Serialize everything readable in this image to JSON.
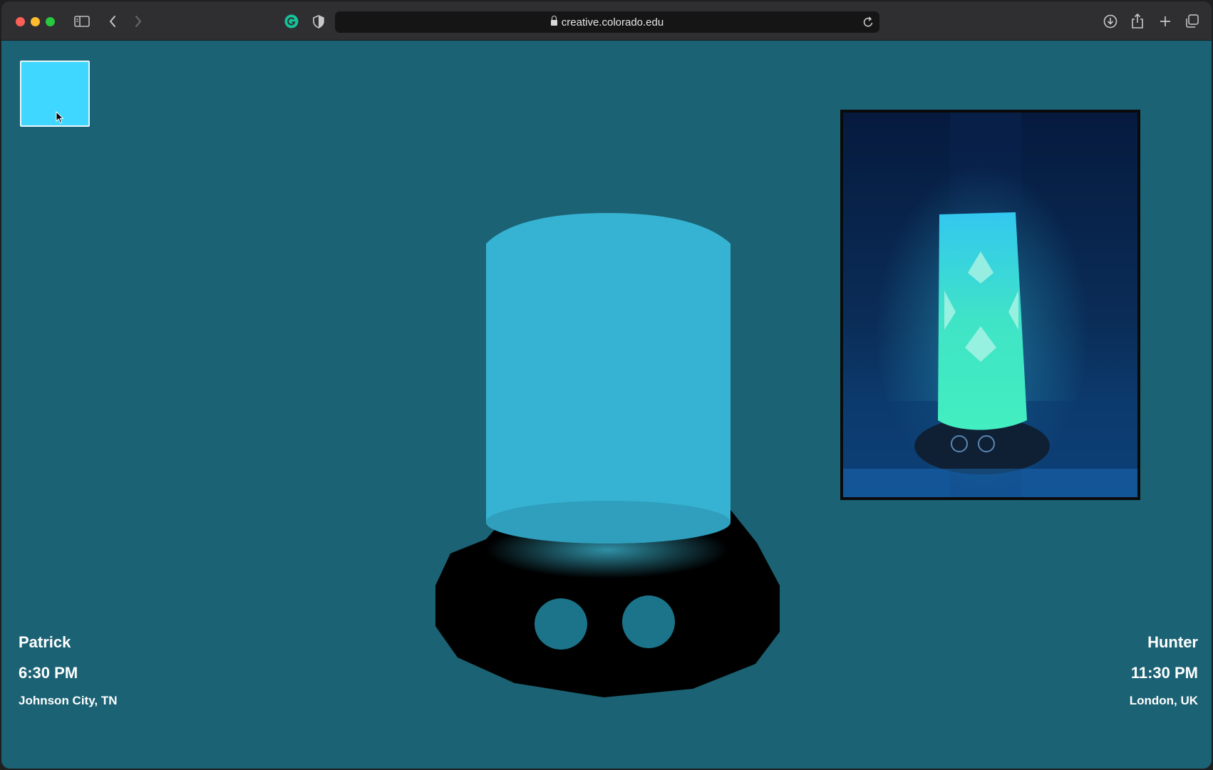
{
  "browser": {
    "url": "creative.colorado.edu"
  },
  "colors": {
    "page_background": "#1b6274",
    "lamp_glow": "#38b3d2",
    "lamp_base": "#000000",
    "selected_swatch": "#3fd6ff"
  },
  "color_picker": {
    "current_color": "#3fd6ff"
  },
  "left_user": {
    "name": "Patrick",
    "time": "6:30 PM",
    "location": "Johnson City, TN"
  },
  "right_user": {
    "name": "Hunter",
    "time": "11:30 PM",
    "location": "London, UK"
  },
  "icons": [
    "sidebar-icon",
    "back-icon",
    "forward-icon",
    "grammarly-icon",
    "shield-icon",
    "lock-icon",
    "reload-icon",
    "download-icon",
    "share-icon",
    "new-tab-icon",
    "tab-overview-icon",
    "cursor-icon"
  ]
}
